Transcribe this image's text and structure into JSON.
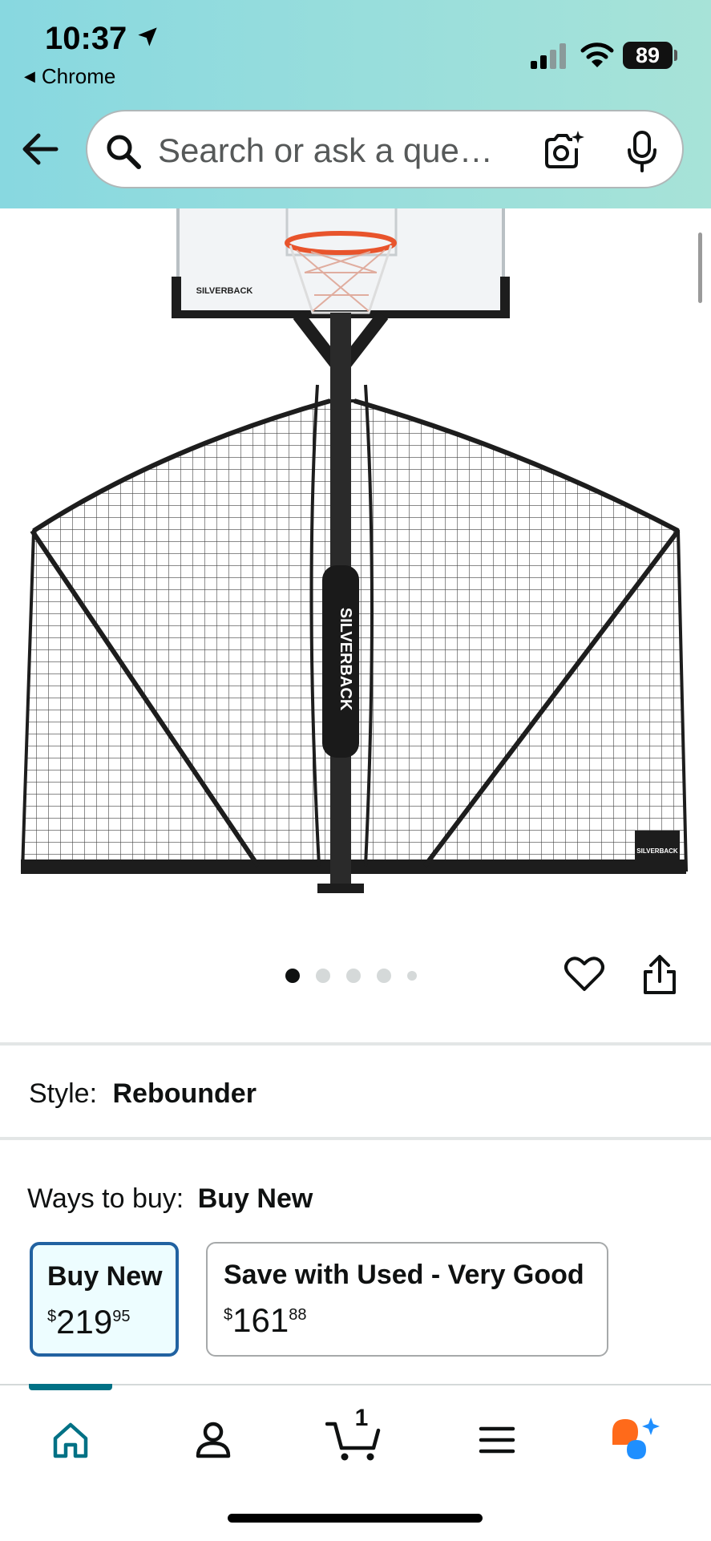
{
  "status_bar": {
    "time": "10:37",
    "back_app": "Chrome",
    "battery": "89"
  },
  "search": {
    "placeholder": "Search or ask a que…"
  },
  "icons": {
    "back": "back-arrow-icon",
    "search": "search-icon",
    "camera": "camera-lens-icon",
    "mic": "microphone-icon",
    "heart": "heart-icon",
    "share": "share-icon",
    "home": "home-icon",
    "account": "person-icon",
    "cart": "cart-icon",
    "menu": "hamburger-icon",
    "rufus": "chat-sparkle-icon"
  },
  "product": {
    "image_brand_text": "SILVERBACK",
    "carousel": {
      "count": 5,
      "active_index": 0
    }
  },
  "style": {
    "label": "Style:",
    "value": "Rebounder"
  },
  "ways_to_buy": {
    "label": "Ways to buy:",
    "value": "Buy New",
    "options": [
      {
        "title": "Buy New",
        "currency": "$",
        "whole": "219",
        "fraction": "95",
        "selected": true
      },
      {
        "title": "Save with Used - Very Good",
        "currency": "$",
        "whole": "161",
        "fraction": "88",
        "selected": false
      }
    ]
  },
  "bottom_nav": {
    "cart_count": "1",
    "active": "home"
  },
  "colors": {
    "header_start": "#88d8e0",
    "header_end": "#a7e3d8",
    "selected_border": "#2162a1",
    "selected_bg": "#edfdff",
    "nav_active": "#007185",
    "rufus_orange": "#ff6a1a",
    "rufus_blue": "#1f8fff"
  }
}
